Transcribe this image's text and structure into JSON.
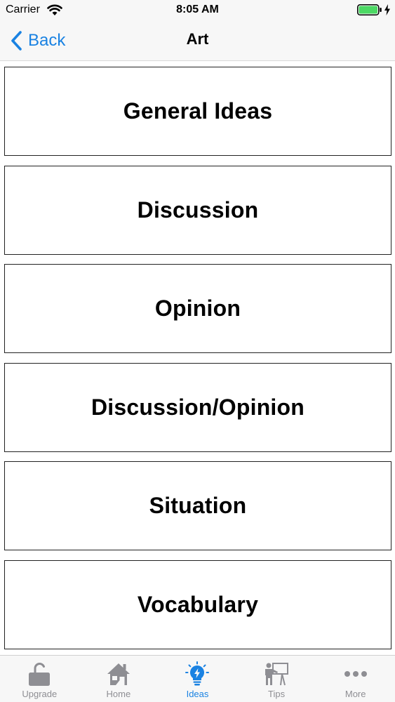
{
  "status_bar": {
    "carrier": "Carrier",
    "time": "8:05 AM"
  },
  "nav": {
    "back_label": "Back",
    "title": "Art"
  },
  "categories": [
    {
      "label": "General Ideas"
    },
    {
      "label": "Discussion"
    },
    {
      "label": "Opinion"
    },
    {
      "label": "Discussion/Opinion"
    },
    {
      "label": "Situation"
    },
    {
      "label": "Vocabulary"
    }
  ],
  "tabs": [
    {
      "label": "Upgrade",
      "icon": "lock-open-icon",
      "active": false
    },
    {
      "label": "Home",
      "icon": "home-icon",
      "active": false
    },
    {
      "label": "Ideas",
      "icon": "lightbulb-icon",
      "active": true
    },
    {
      "label": "Tips",
      "icon": "teacher-board-icon",
      "active": false
    },
    {
      "label": "More",
      "icon": "more-dots-icon",
      "active": false
    }
  ],
  "colors": {
    "accent": "#1a82e2",
    "inactive": "#8e8e93",
    "bar_background": "#f7f7f7",
    "battery": "#4cd964"
  }
}
